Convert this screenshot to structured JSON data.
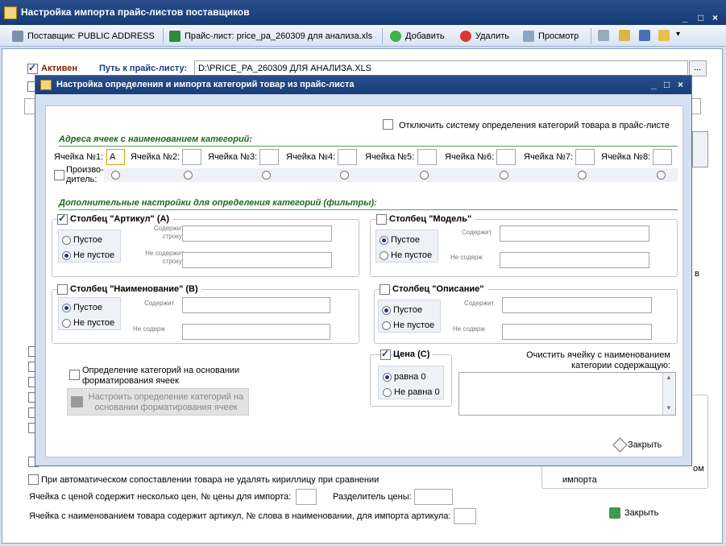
{
  "app": {
    "title": "Настройка импорта прайс-листов поставщиков"
  },
  "toolbar": {
    "supplier": "Поставщик: PUBLIC ADDRESS",
    "pricelist": "Прайс-лист: price_pa_260309 для анализа.xls",
    "add": "Добавить",
    "delete": "Удалить",
    "preview": "Просмотр"
  },
  "main": {
    "active_label": "Активен",
    "path_label": "Путь к прайс-листу:",
    "path_value": "D:\\PRICE_PA_260309 ДЛЯ АНАЛИЗА.XLS",
    "browse": "...",
    "keep_cyrillic": "При автоматическом сопоставлении товара не удалять кириллицу при сравнении",
    "multi_price": "Ячейка с ценой содержит несколько цен, № цены для импорта:",
    "price_sep": "Разделитель цены:",
    "article_word": "Ячейка с наименованием товара содержит артикул, № слова в наименовании, для импорта артикула:",
    "side_text_1": "ом",
    "side_text_2": "импорта",
    "side_text_3": "в",
    "close": "Закрыть"
  },
  "dialog": {
    "title": "Настройка определения и импорта категорий товар из прайс-листа",
    "disable_label": "Отключить систему определения категорий товара в прайс-листе",
    "cells_header": "Адреса ячеек с наименованием категорий:",
    "cells": [
      {
        "label": "Ячейка №1:",
        "value": "A"
      },
      {
        "label": "Ячейка №2:",
        "value": ""
      },
      {
        "label": "Ячейка №3:",
        "value": ""
      },
      {
        "label": "Ячейка №4:",
        "value": ""
      },
      {
        "label": "Ячейка №5:",
        "value": ""
      },
      {
        "label": "Ячейка №6:",
        "value": ""
      },
      {
        "label": "Ячейка №7:",
        "value": ""
      },
      {
        "label": "Ячейка №8:",
        "value": ""
      }
    ],
    "manufacturer": "Произво-\nдитель:",
    "filters_header": "Дополнительные настройки для определения категорий (фильтры):",
    "art": {
      "title": "Столбец \"Артикул\" (A)",
      "empty": "Пустое",
      "not_empty": "Не пустое",
      "contains": "Содержит строку:",
      "not_contains": "Не содержит строку:"
    },
    "model": {
      "title": "Столбец \"Модель\"",
      "empty": "Пустое",
      "not_empty": "Не пустое",
      "contains": "Содержит",
      "not_contains": "Не содерж"
    },
    "name": {
      "title": "Столбец \"Наименование\" (B)",
      "empty": "Пустое",
      "not_empty": "Не пустое",
      "contains": "Содержит",
      "not_contains": "Не содерж"
    },
    "desc": {
      "title": "Столбец \"Описание\"",
      "empty": "Пустое",
      "not_empty": "Не пустое",
      "contains": "Содержит",
      "not_contains": "Не содерж"
    },
    "format_label": "Определение категорий на основании форматирования ячеек",
    "format_button": "Настроить определение категорий на основании форматирования ячеек",
    "price": {
      "title": "Цена (C)",
      "eq": "равна 0",
      "neq": "Не равна 0"
    },
    "clear_label": "Очистить ячейку с наименованием категории содержащую:",
    "close": "Закрыть"
  }
}
